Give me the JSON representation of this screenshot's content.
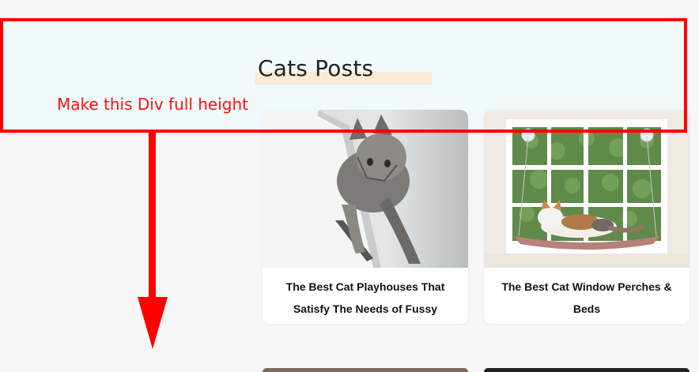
{
  "section": {
    "title": "Cats Posts"
  },
  "annotation": {
    "note": "Make this Div full height",
    "color": "#ff0000"
  },
  "posts": [
    {
      "title": "The Best Cat Playhouses That Satisfy The Needs of Fussy",
      "image": "cat-on-white-wall-photo"
    },
    {
      "title": "The Best Cat Window Perches & Beds",
      "image": "cat-on-window-perch-photo"
    }
  ],
  "colors": {
    "header_background": "#f1f9fb",
    "page_background": "#f7f7f7",
    "title_highlight": "#fbe7cf"
  }
}
